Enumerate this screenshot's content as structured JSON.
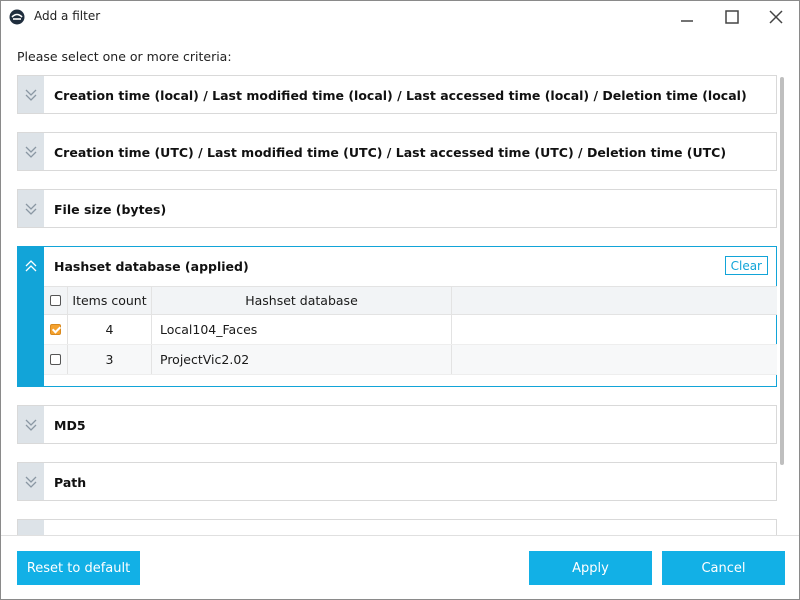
{
  "window": {
    "title": "Add a filter"
  },
  "prompt": "Please select one or more criteria:",
  "sections": [
    {
      "title": "Creation time (local) / Last modified time (local) / Last accessed time (local) / Deletion time (local)",
      "expanded": false
    },
    {
      "title": "Creation time (UTC) / Last modified time (UTC) / Last accessed time (UTC) / Deletion time (UTC)",
      "expanded": false
    },
    {
      "title": "File size (bytes)",
      "expanded": false
    },
    {
      "title": "Hashset database (applied)",
      "expanded": true,
      "clear_label": "Clear"
    },
    {
      "title": "MD5",
      "expanded": false
    },
    {
      "title": "Path",
      "expanded": false
    }
  ],
  "hashset_grid": {
    "columns": [
      "Items count",
      "Hashset database"
    ],
    "rows": [
      {
        "checked": true,
        "count": "4",
        "database": "Local104_Faces"
      },
      {
        "checked": false,
        "count": "3",
        "database": "ProjectVic2.02"
      }
    ]
  },
  "footer": {
    "reset_label": "Reset to default",
    "apply_label": "Apply",
    "cancel_label": "Cancel"
  },
  "colors": {
    "accent": "#12a4d8",
    "button": "#12b0e6",
    "checkbox_checked": "#f4a12e",
    "toggle_bg": "#dde3e8"
  },
  "icons": {
    "app": "app-logo-icon",
    "minimize": "minimize-icon",
    "maximize": "maximize-icon",
    "close": "close-icon",
    "expand": "chevron-double-down-icon",
    "collapse": "chevron-double-up-icon"
  }
}
